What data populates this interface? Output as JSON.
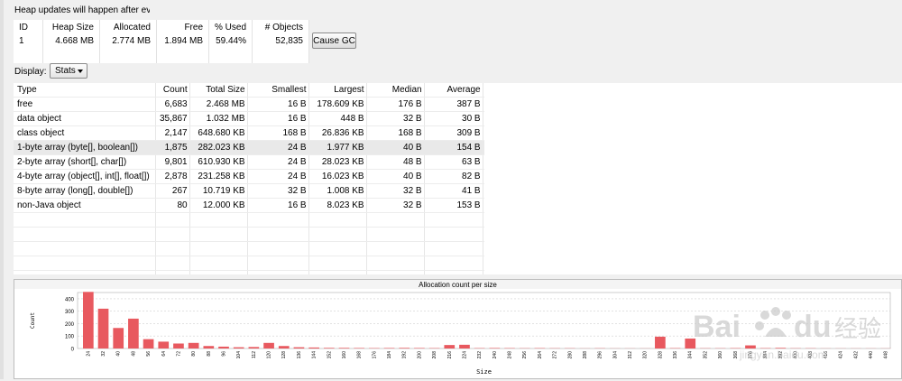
{
  "notice": "Heap updates will happen after eve",
  "summary": {
    "headers": [
      "ID",
      "Heap Size",
      "Allocated",
      "Free",
      "% Used",
      "# Objects"
    ],
    "row": [
      "1",
      "4.668 MB",
      "2.774 MB",
      "1.894 MB",
      "59.44%",
      "52,835"
    ]
  },
  "cause_gc_label": "Cause GC",
  "display": {
    "label": "Display:",
    "selected": "Stats"
  },
  "stats": {
    "headers": [
      "Type",
      "Count",
      "Total Size",
      "Smallest",
      "Largest",
      "Median",
      "Average"
    ],
    "rows": [
      [
        "free",
        "6,683",
        "2.468 MB",
        "16 B",
        "178.609 KB",
        "176 B",
        "387 B"
      ],
      [
        "data object",
        "35,867",
        "1.032 MB",
        "16 B",
        "448 B",
        "32 B",
        "30 B"
      ],
      [
        "class object",
        "2,147",
        "648.680 KB",
        "168 B",
        "26.836 KB",
        "168 B",
        "309 B"
      ],
      [
        "1-byte array (byte[], boolean[])",
        "1,875",
        "282.023 KB",
        "24 B",
        "1.977 KB",
        "40 B",
        "154 B"
      ],
      [
        "2-byte array (short[], char[])",
        "9,801",
        "610.930 KB",
        "24 B",
        "28.023 KB",
        "48 B",
        "63 B"
      ],
      [
        "4-byte array (object[], int[], float[])",
        "2,878",
        "231.258 KB",
        "24 B",
        "16.023 KB",
        "40 B",
        "82 B"
      ],
      [
        "8-byte array (long[], double[])",
        "267",
        "10.719 KB",
        "32 B",
        "1.008 KB",
        "32 B",
        "41 B"
      ],
      [
        "non-Java object",
        "80",
        "12.000 KB",
        "16 B",
        "8.023 KB",
        "32 B",
        "153 B"
      ]
    ],
    "selected_row": 3
  },
  "chart_data": {
    "type": "bar",
    "title": "Allocation count per size",
    "xlabel": "Size",
    "ylabel": "Count",
    "ylim": [
      0,
      450
    ],
    "yticks": [
      0,
      100,
      200,
      300,
      400
    ],
    "grid": true,
    "categories": [
      "24",
      "32",
      "40",
      "48",
      "56",
      "64",
      "72",
      "80",
      "88",
      "96",
      "104",
      "112",
      "120",
      "128",
      "136",
      "144",
      "152",
      "160",
      "168",
      "176",
      "184",
      "192",
      "200",
      "208",
      "216",
      "224",
      "232",
      "240",
      "248",
      "256",
      "264",
      "272",
      "280",
      "288",
      "296",
      "304",
      "312",
      "320",
      "328",
      "336",
      "344",
      "352",
      "360",
      "368",
      "376",
      "384",
      "392",
      "400",
      "408",
      "416",
      "424",
      "432",
      "440",
      "448"
    ],
    "values": [
      455,
      320,
      165,
      240,
      75,
      55,
      40,
      45,
      20,
      15,
      10,
      12,
      45,
      20,
      10,
      8,
      5,
      5,
      4,
      3,
      4,
      5,
      4,
      3,
      28,
      30,
      3,
      4,
      3,
      2,
      3,
      2,
      2,
      1,
      2,
      1,
      1,
      1,
      95,
      3,
      80,
      2,
      2,
      3,
      25,
      3,
      5,
      2,
      2,
      1,
      1,
      1,
      1,
      1
    ]
  },
  "watermark": "Bai du 经验 jingyan.baidu.com"
}
